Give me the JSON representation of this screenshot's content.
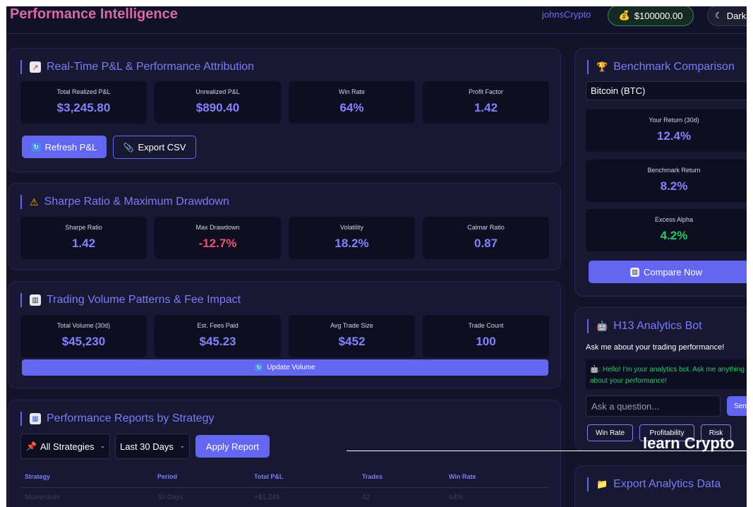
{
  "header": {
    "title": "Performance Intelligence",
    "username": "johnsCrypto",
    "balance_icon": "money-bag-icon",
    "balance": "$100000.00",
    "theme_label": "Dark"
  },
  "pnl": {
    "title": "Real-Time P&L & Performance Attribution",
    "metrics": [
      {
        "label": "Total Realized P&L",
        "value": "$3,245.80"
      },
      {
        "label": "Unrealized P&L",
        "value": "$890.40"
      },
      {
        "label": "Win Rate",
        "value": "64%"
      },
      {
        "label": "Profit Factor",
        "value": "1.42"
      }
    ],
    "refresh_label": "Refresh P&L",
    "export_label": "Export CSV"
  },
  "sharpe": {
    "title": "Sharpe Ratio & Maximum Drawdown",
    "metrics": [
      {
        "label": "Sharpe Ratio",
        "value": "1.42"
      },
      {
        "label": "Max Drawdown",
        "value": "-12.7%"
      },
      {
        "label": "Volatility",
        "value": "18.2%"
      },
      {
        "label": "Calmar Ratio",
        "value": "0.87"
      }
    ]
  },
  "volume": {
    "title": "Trading Volume Patterns & Fee Impact",
    "metrics": [
      {
        "label": "Total Volume (30d)",
        "value": "$45,230"
      },
      {
        "label": "Est. Fees Paid",
        "value": "$45.23"
      },
      {
        "label": "Avg Trade Size",
        "value": "$452"
      },
      {
        "label": "Trade Count",
        "value": "100"
      }
    ],
    "update_label": "Update Volume"
  },
  "reports": {
    "title": "Performance Reports by Strategy",
    "strategy_select": "All Strategies",
    "period_select": "Last 30 Days",
    "apply_label": "Apply Report",
    "columns": [
      "Strategy",
      "Period",
      "Total P&L",
      "Trades",
      "Win Rate"
    ],
    "rows": [
      [
        "Momentum",
        "30 Days",
        "+$1,245",
        "42",
        "64%"
      ]
    ]
  },
  "benchmark": {
    "title": "Benchmark Comparison",
    "select": "Bitcoin (BTC)",
    "metrics": [
      {
        "label": "Your Return (30d)",
        "value": "12.4%"
      },
      {
        "label": "Benchmark Return",
        "value": "8.2%"
      },
      {
        "label": "Excess Alpha",
        "value": "4.2%"
      }
    ],
    "compare_label": "Compare Now"
  },
  "bot": {
    "title": "H13 Analytics Bot",
    "subtitle": "Ask me about your trading performance!",
    "message": ": Hello! I'm your analytics bot. Ask me anything about your performance!",
    "input_placeholder": "Ask a question...",
    "send_label": "Send",
    "quick": [
      "Win Rate",
      "Profitability",
      "Risk"
    ]
  },
  "export": {
    "title": "Export Analytics Data"
  },
  "overlay": {
    "watermark": "learn Crypto"
  },
  "colors": {
    "background": "#13132a",
    "card": "#181834",
    "accent": "#6366f1",
    "title_pink": "#d86aa6",
    "positive": "#27c96a",
    "negative": "#f0506a"
  }
}
